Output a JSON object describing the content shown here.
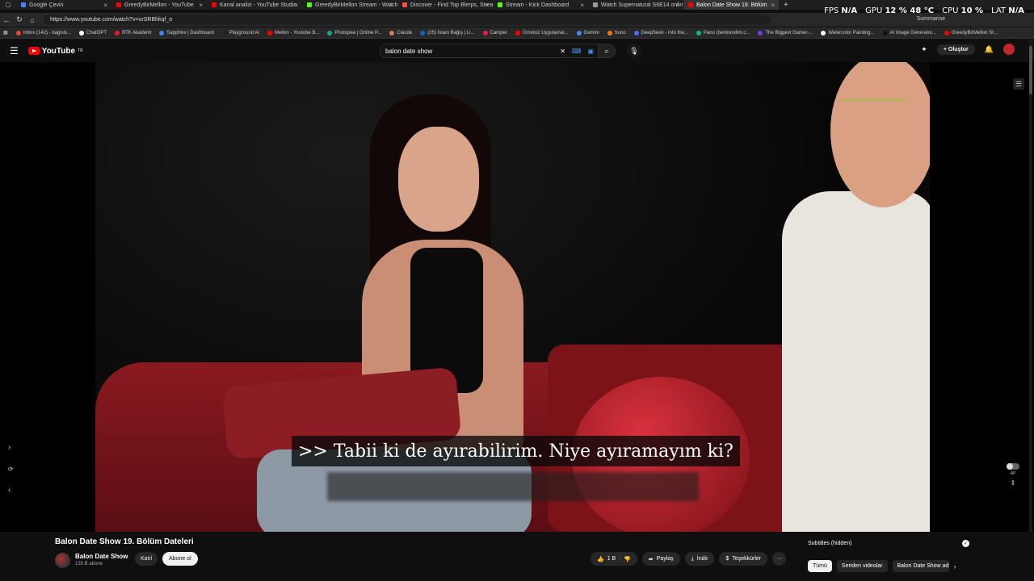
{
  "browser": {
    "tabs": [
      {
        "title": "Google Çeviri",
        "color": "#4285f4"
      },
      {
        "title": "GreedyBirMellon - YouTube",
        "color": "#ff0000"
      },
      {
        "title": "Kanal analizi - YouTube Studio",
        "color": "#ff0000"
      },
      {
        "title": "GreedyBirMellon Stream - Watch",
        "color": "#53fc18"
      },
      {
        "title": "Discover - Find Top Blerps, Stream",
        "color": "#ff4b4b"
      },
      {
        "title": "Stream - Kick Dashboard",
        "color": "#53fc18"
      },
      {
        "title": "Watch Supernatural S6E14 onlin",
        "color": "#999999"
      },
      {
        "title": "Balon Date Show 19. Bölüm",
        "color": "#ff0000"
      }
    ],
    "new_tab": "+",
    "url": "https://www.youtube.com/watch?v=urSRBhkqf_o",
    "summarise": "Summarise",
    "bookmarks": [
      {
        "label": "Inbox (142) - bagisis...",
        "color": "#ea4335"
      },
      {
        "label": "ChatGPT",
        "color": "#ffffff"
      },
      {
        "label": "BTK Akademi",
        "color": "#e21b2d"
      },
      {
        "label": "Sapphire | Dashboard",
        "color": "#3b82f6"
      },
      {
        "label": "Playground AI",
        "color": "#222222"
      },
      {
        "label": "Mellon - Youtube B...",
        "color": "#ff0000"
      },
      {
        "label": "Photopea | Online P...",
        "color": "#18a497"
      },
      {
        "label": "Claude",
        "color": "#d97757"
      },
      {
        "label": "(25) İslam Bağış | Li...",
        "color": "#0a66c2"
      },
      {
        "label": "Camper",
        "color": "#e11d48"
      },
      {
        "label": "Ücretsiz Uygulamal...",
        "color": "#ff0000"
      },
      {
        "label": "Gemini",
        "color": "#4285f4"
      },
      {
        "label": "Suno",
        "color": "#f97316"
      },
      {
        "label": "DeepSeek - Into the...",
        "color": "#4d6bfe"
      },
      {
        "label": "Pano (bentrendim.c...",
        "color": "#10b981"
      },
      {
        "label": "The Biggest Gamer-...",
        "color": "#7c3aed"
      },
      {
        "label": "Watercolor Painting...",
        "color": "#ffffff"
      },
      {
        "label": "AI Image Generator...",
        "color": "#111111"
      },
      {
        "label": "GreedyBirMellon St...",
        "color": "#ff0000"
      }
    ]
  },
  "hud": {
    "fps_label": "FPS",
    "fps_value": "N/A",
    "gpu_label": "GPU",
    "gpu_value": "12 % 48 °C",
    "cpu_label": "CPU",
    "cpu_value": "10 %",
    "lat_label": "LAT",
    "lat_value": "N/A"
  },
  "youtube": {
    "logo_text": "YouTube",
    "region": "TR",
    "search_query": "balon date show",
    "create_label": "Oluştur"
  },
  "player": {
    "subtitle_line": ">> Tabii ki de ayırabilirim. Niye ayıramayım ki?",
    "autoplay_label": "AP"
  },
  "video": {
    "title": "Balon Date Show 19. Bölüm Dateleri",
    "channel": "Balon Date Show",
    "subscribers": "133 B abone",
    "join_label": "Katıl",
    "subscribe_label": "Abone ol",
    "likes": "1 B",
    "share_label": "Paylaş",
    "download_label": "İndir",
    "thanks_label": "Teşekkürler",
    "more_label": "···"
  },
  "sidepanel": {
    "subtitles_label": "Subtitles (hidden)",
    "chips": [
      "Tümü",
      "Seriden videolar",
      "Balon Date Show adl"
    ]
  },
  "colors": {
    "accent": "#ff0000",
    "background": "#0f0f0f"
  }
}
